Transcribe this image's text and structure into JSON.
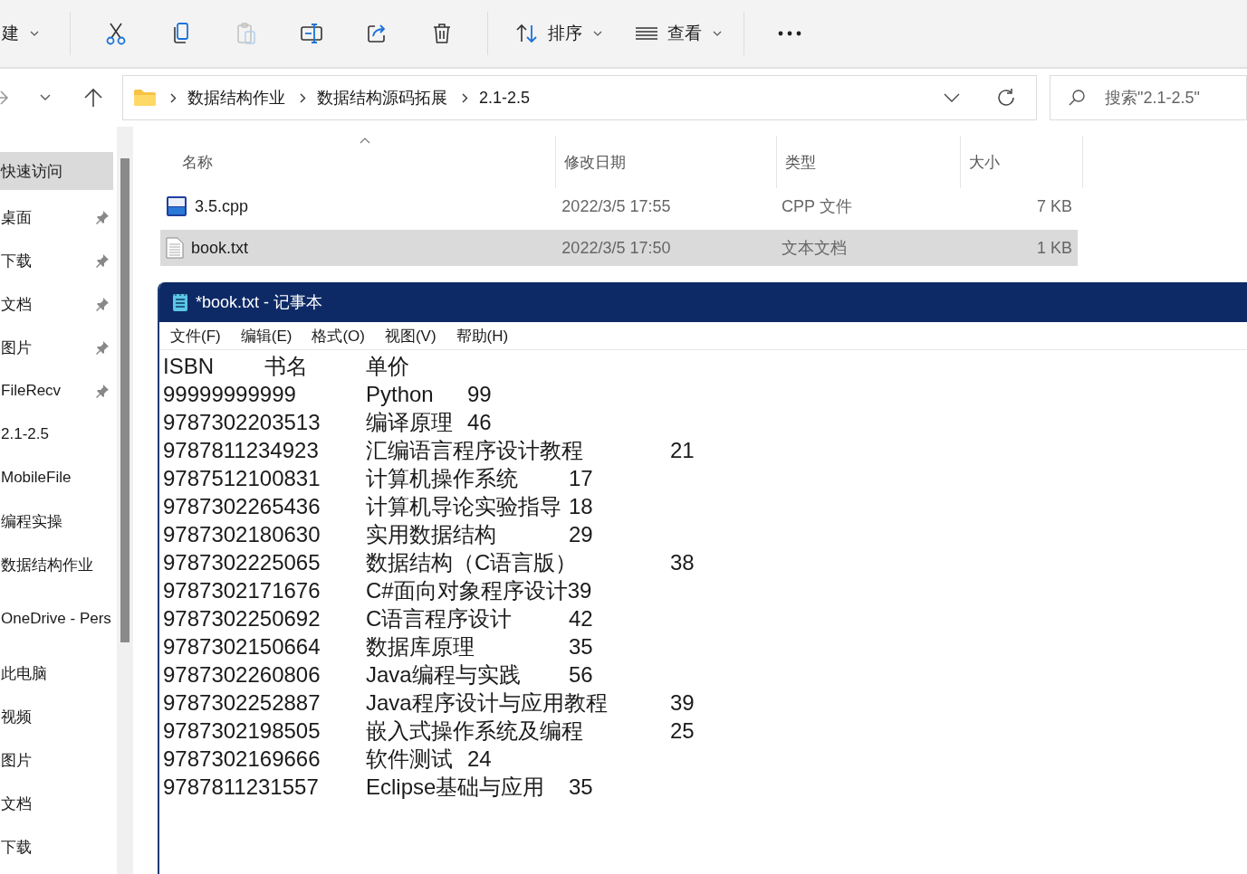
{
  "toolbar": {
    "new_label": "建",
    "paste_disabled": true,
    "sort_label": "排序",
    "view_label": "查看"
  },
  "address": {
    "crumbs": [
      "数据结构作业",
      "数据结构源码拓展",
      "2.1-2.5"
    ],
    "search": {
      "placeholder": "搜索\"2.1-2.5\""
    }
  },
  "sidebar": {
    "sections": [
      {
        "items": [
          {
            "label": "快速访问",
            "selected": true,
            "pinned": false
          },
          {
            "label": "桌面",
            "selected": false,
            "pinned": true
          },
          {
            "label": "下载",
            "selected": false,
            "pinned": true
          },
          {
            "label": "文档",
            "selected": false,
            "pinned": true
          },
          {
            "label": "图片",
            "selected": false,
            "pinned": true
          },
          {
            "label": "FileRecv",
            "selected": false,
            "pinned": true
          },
          {
            "label": "2.1-2.5",
            "selected": false,
            "pinned": false
          },
          {
            "label": "MobileFile",
            "selected": false,
            "pinned": false
          },
          {
            "label": "编程实操",
            "selected": false,
            "pinned": false
          },
          {
            "label": "数据结构作业",
            "selected": false,
            "pinned": false
          }
        ]
      },
      {
        "items": [
          {
            "label": "OneDrive - Pers",
            "selected": false,
            "pinned": false
          }
        ]
      },
      {
        "items": [
          {
            "label": "此电脑",
            "selected": false,
            "pinned": false
          },
          {
            "label": "视频",
            "selected": false,
            "pinned": false
          },
          {
            "label": "图片",
            "selected": false,
            "pinned": false
          },
          {
            "label": "文档",
            "selected": false,
            "pinned": false
          },
          {
            "label": "下载",
            "selected": false,
            "pinned": false
          }
        ]
      }
    ]
  },
  "files": {
    "columns": [
      "名称",
      "修改日期",
      "类型",
      "大小"
    ],
    "rows": [
      {
        "kind": "cpp",
        "name": "3.5.cpp",
        "date": "2022/3/5 17:55",
        "type": "CPP 文件",
        "size": "7 KB",
        "selected": false
      },
      {
        "kind": "txt",
        "name": "book.txt",
        "date": "2022/3/5 17:50",
        "type": "文本文档",
        "size": "1 KB",
        "selected": true
      }
    ]
  },
  "notepad": {
    "title": "*book.txt - 记事本",
    "menu": [
      "文件(F)",
      "编辑(E)",
      "格式(O)",
      "视图(V)",
      "帮助(H)"
    ],
    "lines": [
      "ISBN\t书名\t单价",
      "99999999999\tPython\t99",
      "9787302203513\t编译原理\t46",
      "9787811234923\t汇编语言程序设计教程\t21",
      "9787512100831\t计算机操作系统\t17",
      "9787302265436\t计算机导论实验指导\t18",
      "9787302180630\t实用数据结构\t29",
      "9787302225065\t数据结构（C语言版）\t38",
      "9787302171676\tC#面向对象程序设计39",
      "9787302250692\tC语言程序设计\t42",
      "9787302150664\t数据库原理\t35",
      "9787302260806\tJava编程与实践\t56",
      "9787302252887\tJava程序设计与应用教程\t39",
      "9787302198505\t嵌入式操作系统及编程\t25",
      "9787302169666\t软件测试\t24",
      "9787811231557\tEclipse基础与应用\t35"
    ]
  }
}
